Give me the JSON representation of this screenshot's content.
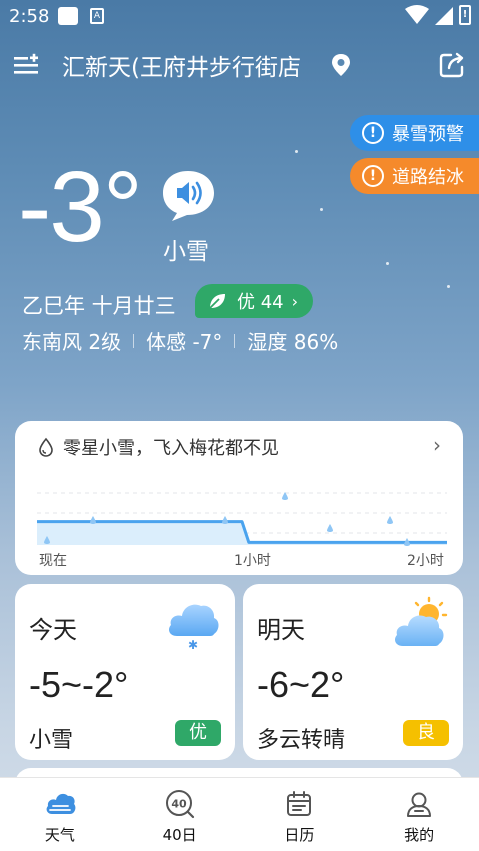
{
  "status_bar": {
    "time": "2:58",
    "a_icon": "A",
    "battery_glyph": "!"
  },
  "header": {
    "location": "汇新天(王府井步行街店",
    "menu_icon": "menu-add-icon",
    "pin_icon": "location-pin-icon",
    "share_icon": "share-icon"
  },
  "alerts": [
    {
      "label": "暴雪预警",
      "color": "#2e8fe8",
      "icon": "!"
    },
    {
      "label": "道路结冰",
      "color": "#f58a2b",
      "icon": "!"
    }
  ],
  "current": {
    "temp": "-3°",
    "condition": "小雪",
    "lunar_date": "乙巳年 十月廿三",
    "aqi": {
      "label": "优 44",
      "chev": "›",
      "color": "#2fa868"
    },
    "wind": "东南风 2级",
    "feels_like": "体感 -7°",
    "humidity": "湿度 86%"
  },
  "precip": {
    "title": "零星小雪，飞入梅花都不见",
    "arrow": "›",
    "ticks": [
      "现在",
      "1小时",
      "2小时"
    ]
  },
  "chart_data": {
    "type": "line",
    "x": [
      "现在",
      "1小时",
      "2小时"
    ],
    "series": [
      {
        "values_by_minute": [
          {
            "t": 0,
            "v": 0.45
          },
          {
            "t": 60,
            "v": 0.45
          },
          {
            "t": 62,
            "v": 0.05
          },
          {
            "t": 120,
            "v": 0.05
          }
        ]
      }
    ],
    "ylim": [
      0,
      1
    ],
    "grid": true
  },
  "days": [
    {
      "name": "今天",
      "range": "-5~-2°",
      "condition": "小雪",
      "aqi": "优",
      "aqi_color": "#2fa868",
      "icon": "snow-cloud-icon"
    },
    {
      "name": "明天",
      "range": "-6~2°",
      "condition": "多云转晴",
      "aqi": "良",
      "aqi_color": "#f5c000",
      "icon": "partly-cloudy-icon"
    }
  ],
  "nav": [
    {
      "label": "天气",
      "icon": "weather-icon"
    },
    {
      "label": "40日",
      "icon": "forty-day-icon",
      "icon_text": "40"
    },
    {
      "label": "日历",
      "icon": "calendar-icon"
    },
    {
      "label": "我的",
      "icon": "profile-icon"
    }
  ]
}
